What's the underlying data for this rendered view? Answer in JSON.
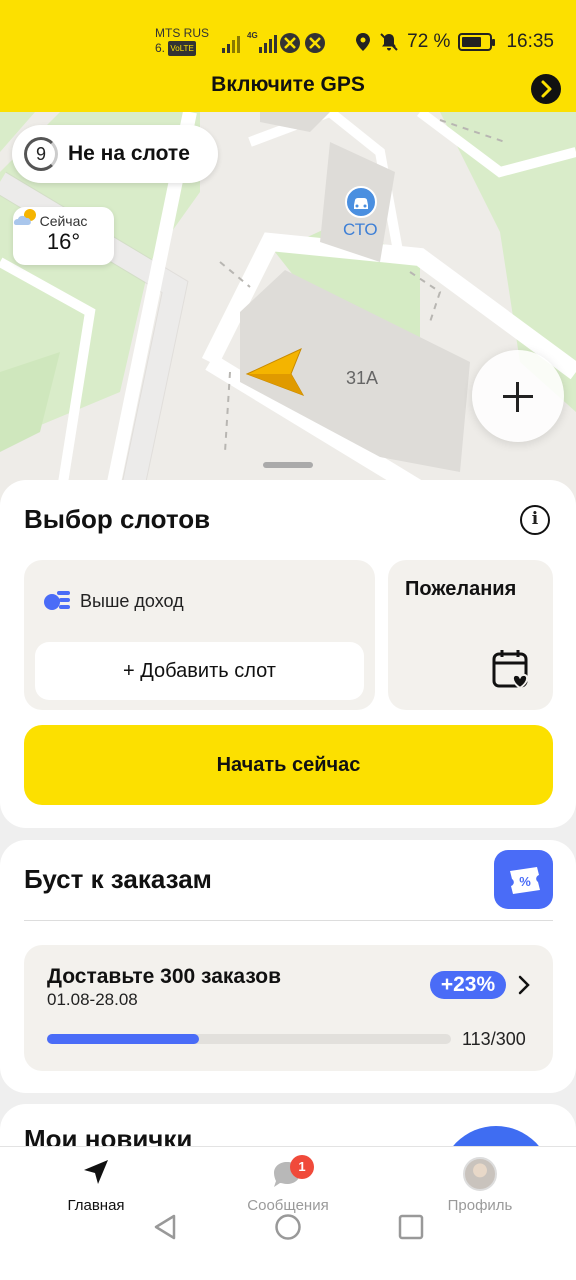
{
  "status_bar": {
    "carrier": "MTS RUS",
    "carrier_sub": "6.",
    "volte": "VoLTE",
    "network_type": "4G",
    "battery_percent": "72 %",
    "battery_level": 0.72,
    "time": "16:35"
  },
  "gps_banner": {
    "text": "Включите GPS"
  },
  "map": {
    "slot_number": "9",
    "slot_status": "Не на слоте",
    "weather_label": "Сейчас",
    "temperature": "16°",
    "poi_label": "СТО",
    "building_label": "31А"
  },
  "slot_card": {
    "title": "Выбор слотов",
    "income_label": "Выше доход",
    "add_slot_label": "+ Добавить слот",
    "wishes_title": "Пожелания",
    "start_button": "Начать сейчас"
  },
  "boost_card": {
    "title": "Буст к заказам",
    "goal_title": "Доставьте 300 заказов",
    "date_range": "01.08-28.08",
    "bonus": "+23%",
    "progress_current": 113,
    "progress_total": 300,
    "progress_text": "113/300"
  },
  "newcomers_card": {
    "title": "Мои новички"
  },
  "bottom_nav": {
    "home": "Главная",
    "messages": "Сообщения",
    "messages_badge": "1",
    "profile": "Профиль"
  },
  "colors": {
    "brand_yellow": "#fce000",
    "accent_blue": "#4a6cf7",
    "badge_red": "#f04a3a"
  }
}
